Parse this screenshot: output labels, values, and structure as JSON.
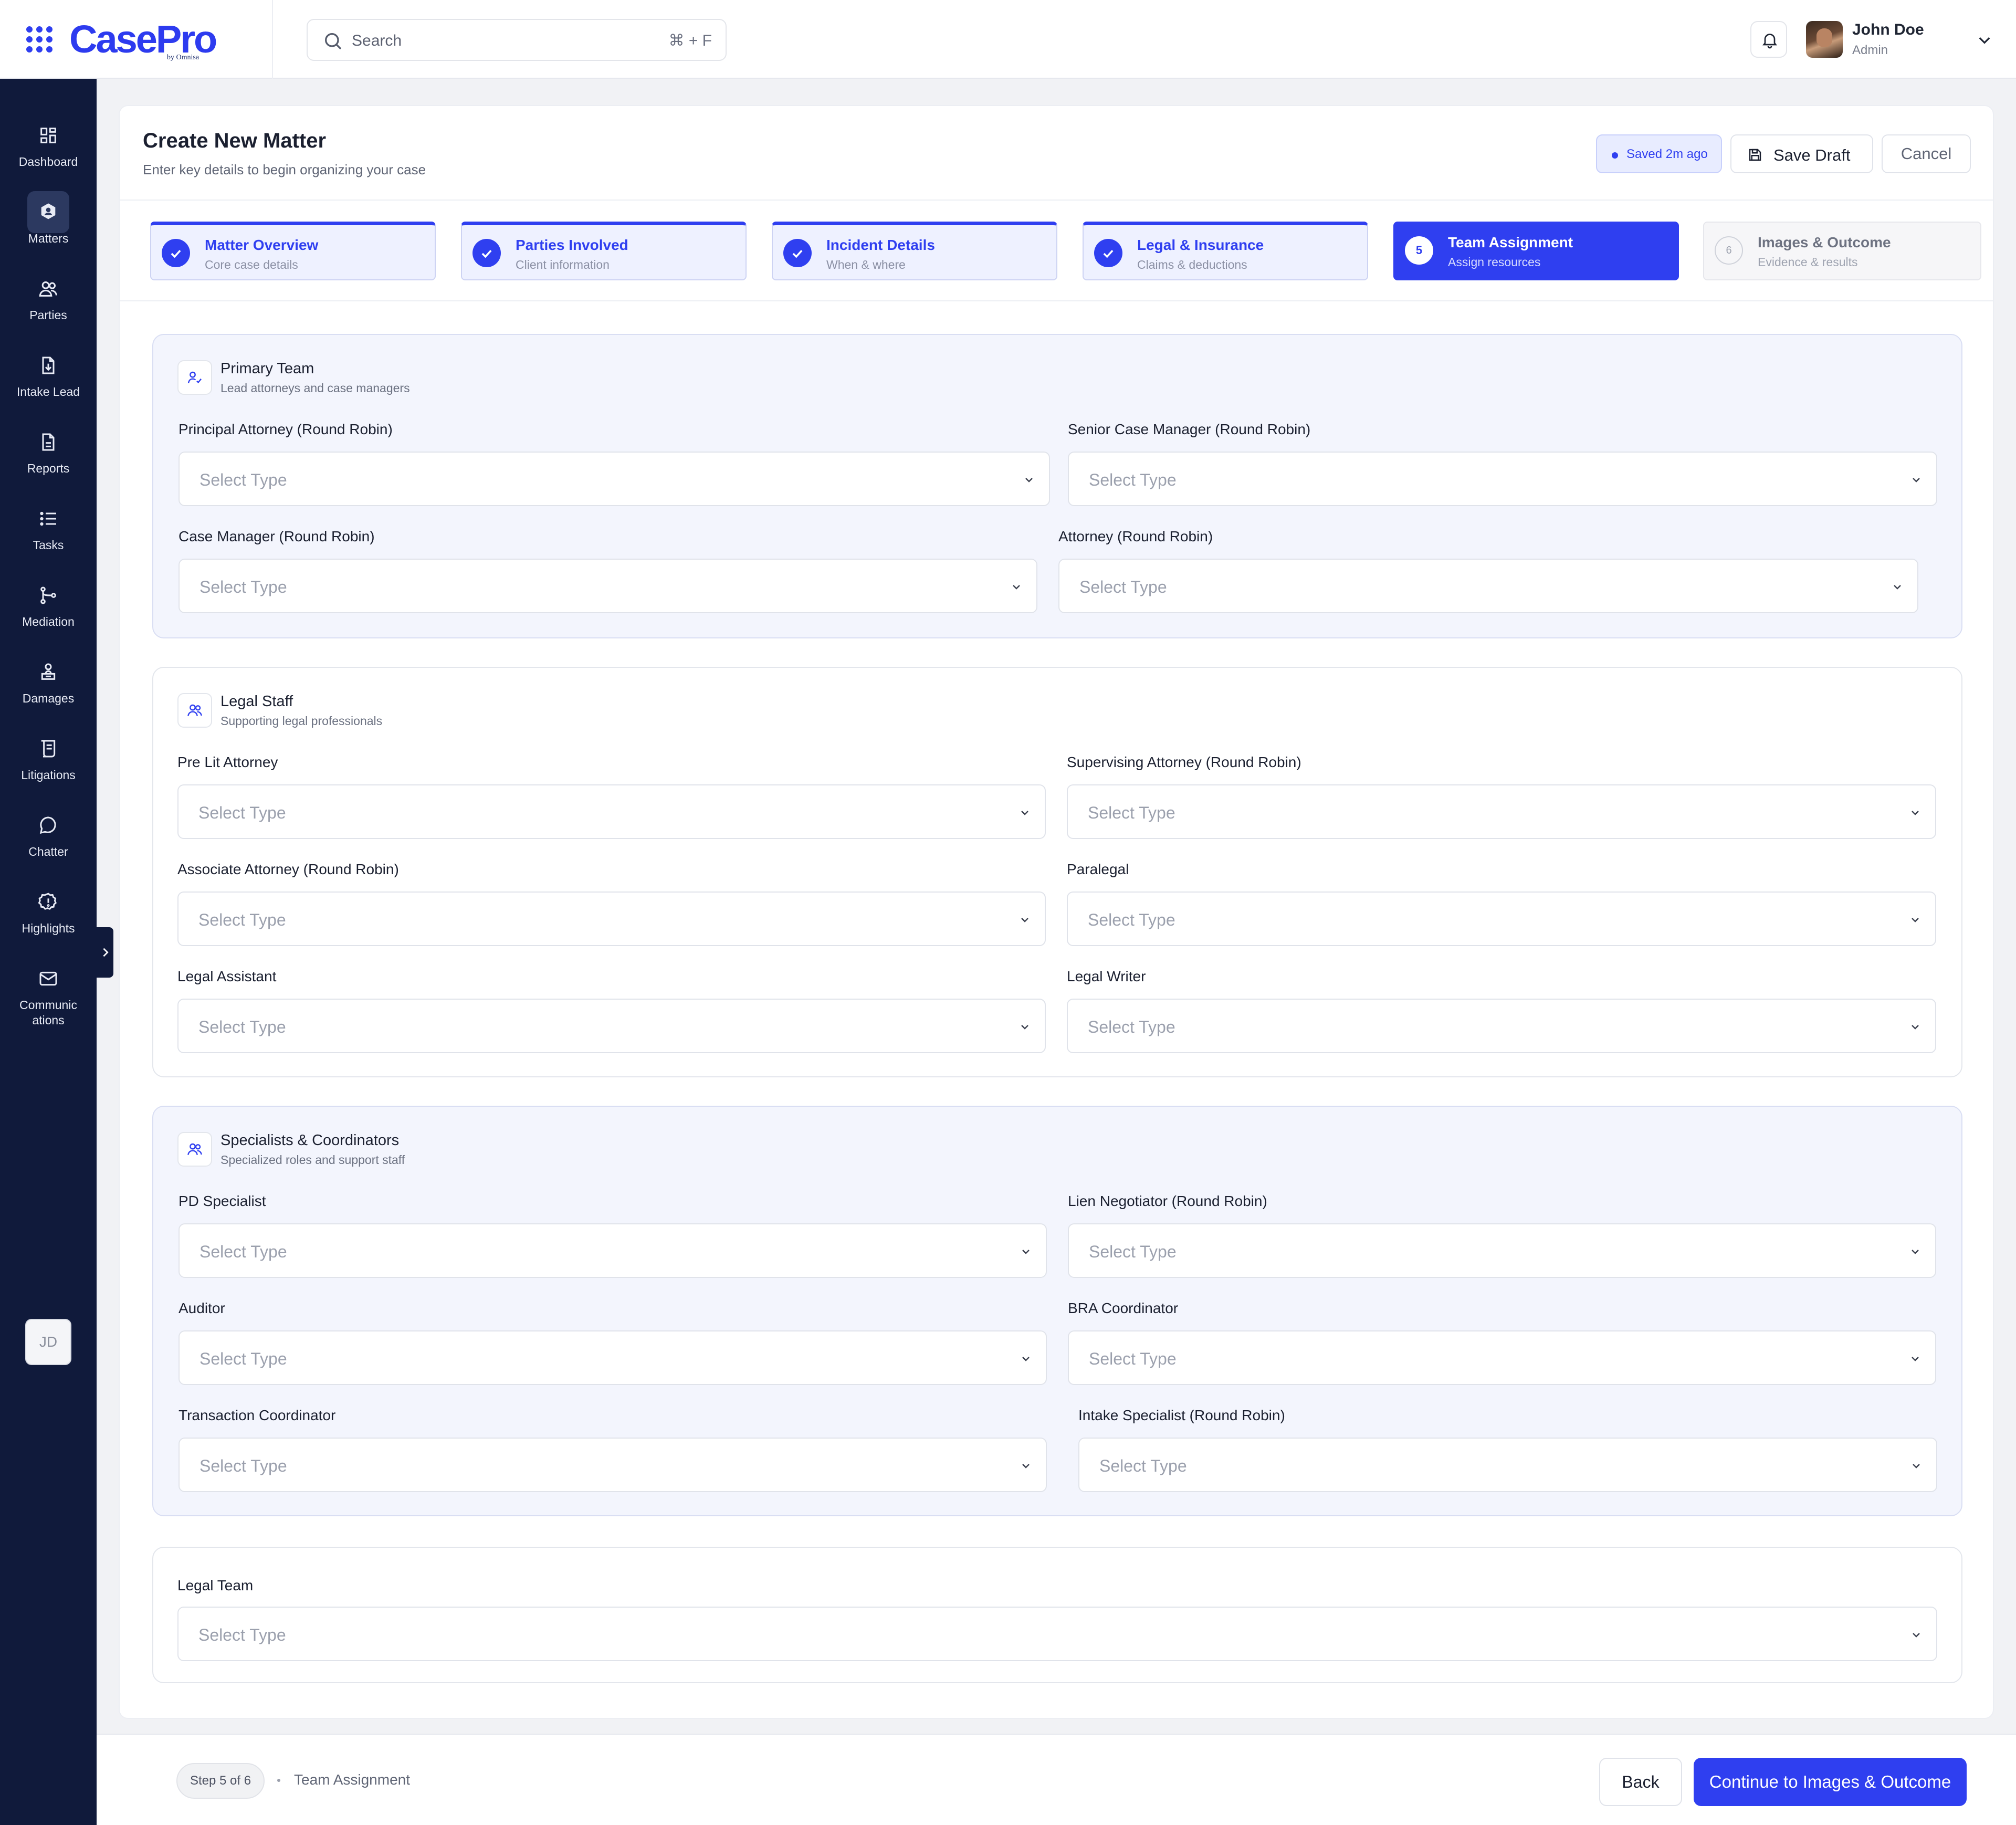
{
  "app": {
    "logo_text": "CasePro",
    "logo_subtext": "by Omnisa"
  },
  "search": {
    "placeholder": "Search",
    "shortcut": "⌘ + F"
  },
  "user": {
    "name": "John Doe",
    "role": "Admin",
    "initials": "JD"
  },
  "sidebar": {
    "items": [
      {
        "label": "Dashboard",
        "icon": "dashboard-icon",
        "active": false
      },
      {
        "label": "Matters",
        "icon": "matters-icon",
        "active": true
      },
      {
        "label": "Parties",
        "icon": "parties-icon",
        "active": false
      },
      {
        "label": "Intake Lead",
        "icon": "intake-lead-icon",
        "active": false
      },
      {
        "label": "Reports",
        "icon": "reports-icon",
        "active": false
      },
      {
        "label": "Tasks",
        "icon": "tasks-icon",
        "active": false
      },
      {
        "label": "Mediation",
        "icon": "mediation-icon",
        "active": false
      },
      {
        "label": "Damages",
        "icon": "damages-icon",
        "active": false
      },
      {
        "label": "Litigations",
        "icon": "litigations-icon",
        "active": false
      },
      {
        "label": "Chatter",
        "icon": "chatter-icon",
        "active": false
      },
      {
        "label": "Highlights",
        "icon": "highlights-icon",
        "active": false
      },
      {
        "label": "Communic ations",
        "icon": "communications-icon",
        "active": false
      }
    ]
  },
  "page": {
    "title": "Create New Matter",
    "subtitle": "Enter key details to begin organizing your case",
    "saved_status": "Saved 2m ago",
    "save_draft_label": "Save Draft",
    "cancel_label": "Cancel"
  },
  "steps": [
    {
      "number": "1",
      "title": "Matter Overview",
      "subtitle": "Core case details",
      "state": "done"
    },
    {
      "number": "2",
      "title": "Parties Involved",
      "subtitle": "Client information",
      "state": "done"
    },
    {
      "number": "3",
      "title": "Incident Details",
      "subtitle": "When & where",
      "state": "done"
    },
    {
      "number": "4",
      "title": "Legal & Insurance",
      "subtitle": "Claims & deductions",
      "state": "done"
    },
    {
      "number": "5",
      "title": "Team Assignment",
      "subtitle": "Assign resources",
      "state": "current"
    },
    {
      "number": "6",
      "title": "Images & Outcome",
      "subtitle": "Evidence & results",
      "state": "pending"
    }
  ],
  "select_placeholder": "Select Type",
  "sections": {
    "primary": {
      "title": "Primary Team",
      "subtitle": "Lead attorneys and case managers",
      "fields": [
        "Principal Attorney (Round Robin)",
        "Senior Case Manager (Round Robin)",
        "Case Manager (Round Robin)",
        "Attorney (Round Robin)"
      ]
    },
    "legal_staff": {
      "title": "Legal Staff",
      "subtitle": "Supporting legal professionals",
      "fields": [
        "Pre Lit Attorney",
        "Supervising Attorney (Round Robin)",
        "Associate Attorney (Round Robin)",
        "Paralegal",
        "Legal Assistant",
        "Legal Writer"
      ]
    },
    "specialists": {
      "title": "Specialists & Coordinators",
      "subtitle": "Specialized roles and support staff",
      "fields": [
        "PD Specialist",
        "Lien Negotiator (Round Robin)",
        "Auditor",
        "BRA Coordinator",
        "Transaction Coordinator",
        "Intake Specialist (Round Robin)"
      ]
    },
    "legal_team": {
      "fields": [
        "Legal Team"
      ]
    }
  },
  "footer": {
    "step_indicator": "Step 5 of 6",
    "current_step": "Team Assignment",
    "back_label": "Back",
    "continue_label": "Continue to Images & Outcome"
  },
  "colors": {
    "primary": "#2f3ff0",
    "sidebar_bg": "#101a3b"
  }
}
